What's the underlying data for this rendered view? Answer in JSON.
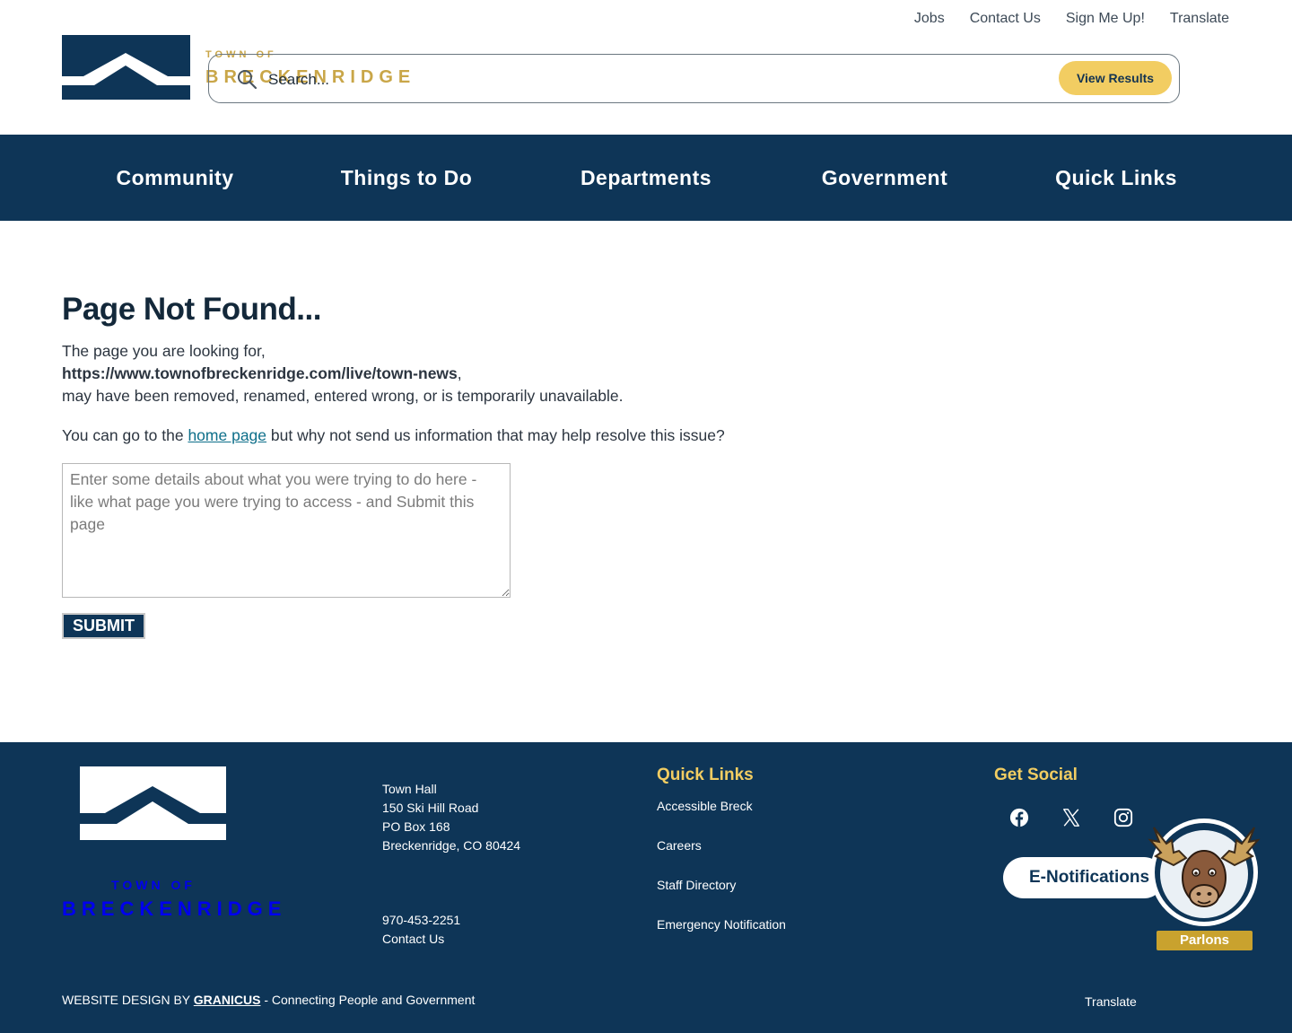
{
  "utility_nav": [
    "Jobs",
    "Contact Us",
    "Sign Me Up!",
    "Translate"
  ],
  "logo": {
    "town_of": "TOWN OF",
    "name": "BRECKENRIDGE"
  },
  "search": {
    "placeholder": "Search...",
    "button": "View Results"
  },
  "main_nav": [
    "Community",
    "Things to Do",
    "Departments",
    "Government",
    "Quick Links"
  ],
  "content": {
    "title": "Page Not Found...",
    "line1": "The page you are looking for,",
    "url": "https://www.townofbreckenridge.com/live/town-news",
    "url_suffix": ",",
    "line3": "may have been removed, renamed, entered wrong, or is temporarily unavailable.",
    "prompt_before": "You can go to the ",
    "home_link": "home page",
    "prompt_after": " but why not send us information that may help resolve this issue?",
    "textarea_placeholder": "Enter some details about what you were trying to do here - like what page you were trying to access - and Submit this page",
    "submit": "SUBMIT"
  },
  "footer": {
    "logo": {
      "town_of": "TOWN OF",
      "name": "BRECKENRIDGE"
    },
    "address": [
      "Town Hall",
      "150 Ski Hill Road",
      "PO Box 168",
      "Breckenridge, CO 80424"
    ],
    "phone": "970-453-2251",
    "contact": "Contact Us",
    "quick_links_heading": "Quick Links",
    "quick_links": [
      "Accessible Breck",
      "Careers",
      "Staff Directory",
      "Emergency Notification"
    ],
    "social_heading": "Get Social",
    "social_icons": [
      "facebook-icon",
      "x-icon",
      "instagram-icon"
    ],
    "enotifications": "E-Notifications",
    "chatbot_label": "Parlons",
    "credit_prefix": "WEBSITE DESIGN BY ",
    "credit_link": "GRANICUS",
    "credit_suffix": " - Connecting People and Government",
    "translate": "Translate"
  },
  "colors": {
    "navy": "#0e3557",
    "gold": "#f2cd62",
    "logo_gold": "#c9a648",
    "link_teal": "#0e6f8a"
  }
}
